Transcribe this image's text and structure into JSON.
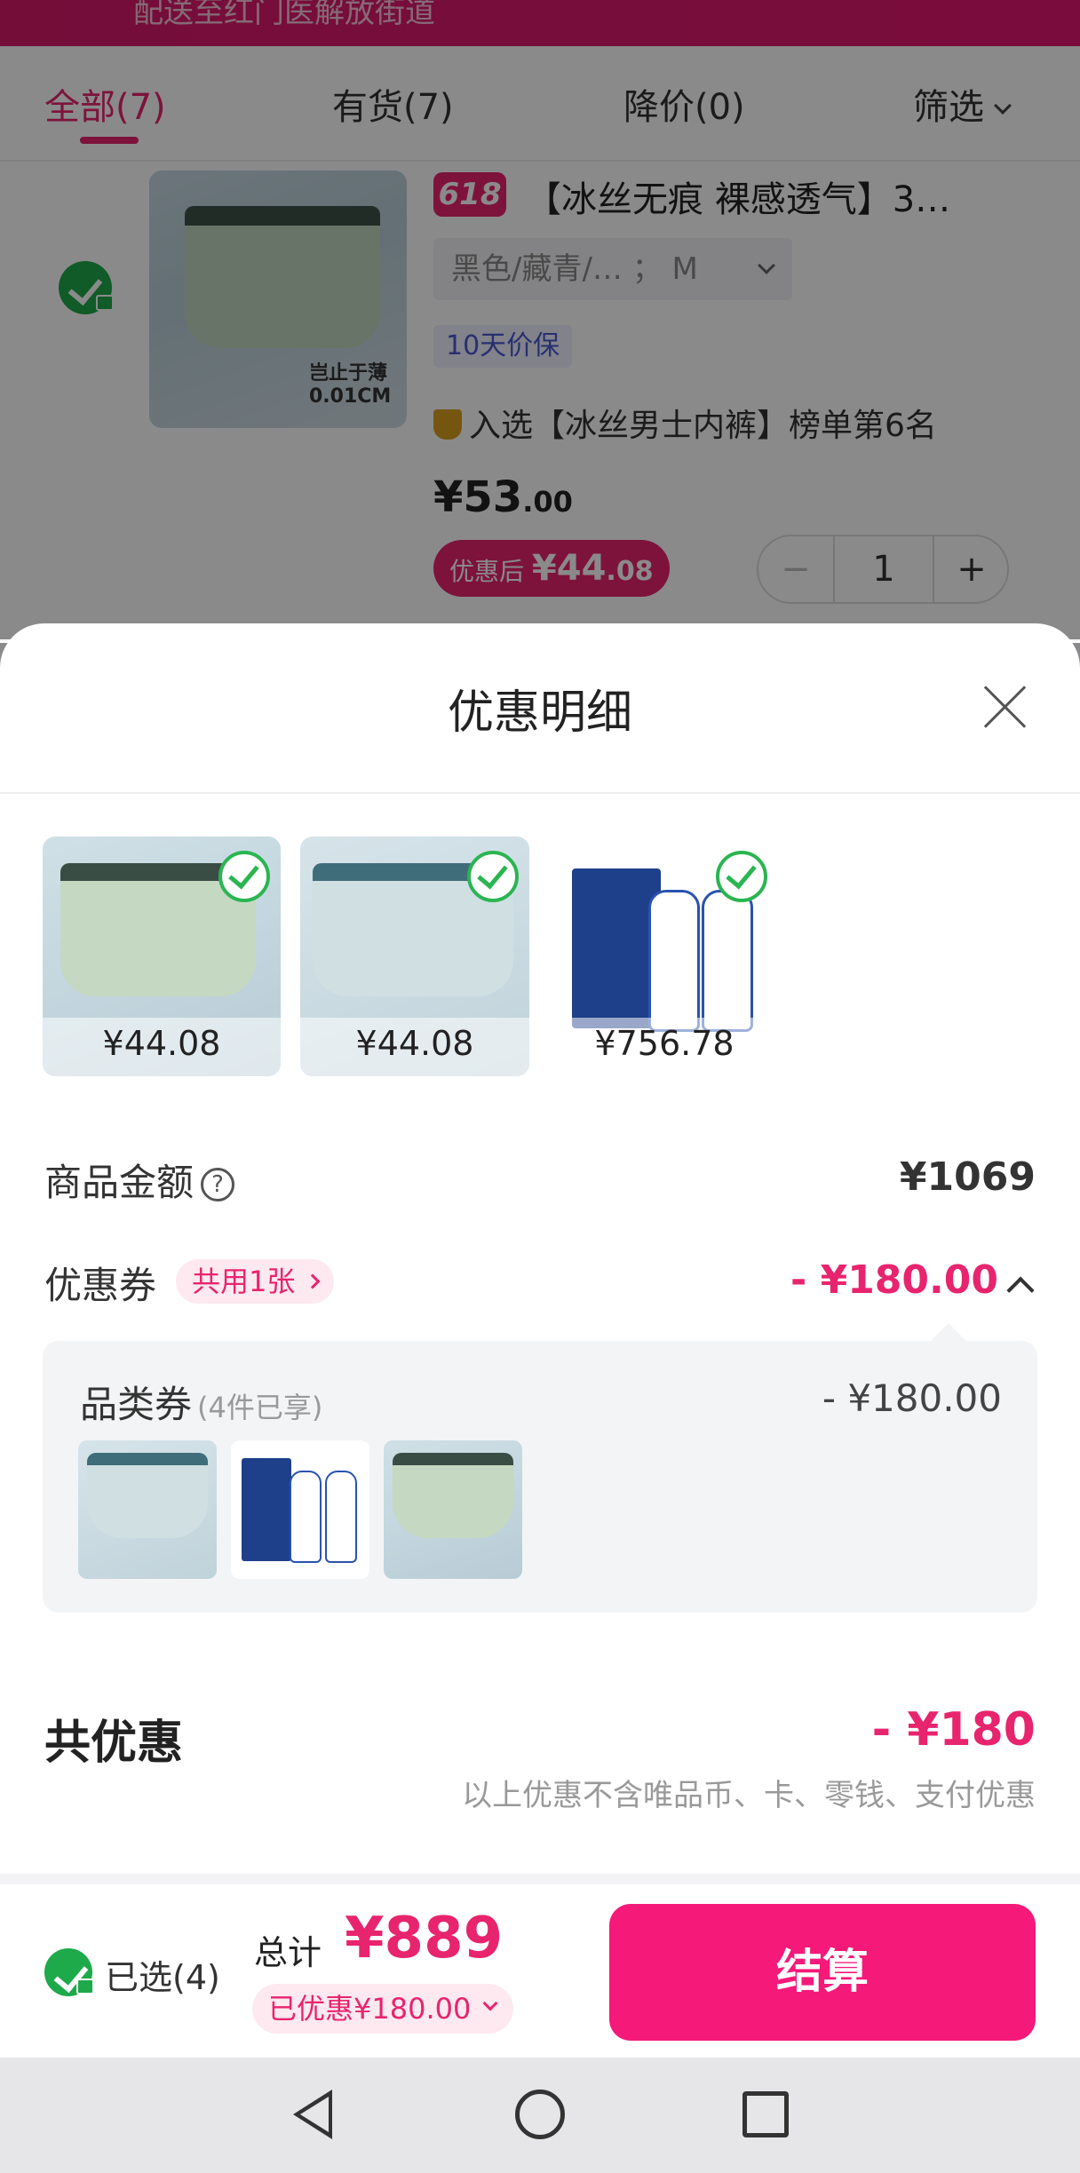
{
  "background": {
    "banner_text": "配送至红门医解放街道",
    "tabs": [
      {
        "label": "全部(7)",
        "active": true
      },
      {
        "label": "有货(7)",
        "active": false
      },
      {
        "label": "降价(0)",
        "active": false
      },
      {
        "label": "筛选",
        "active": false
      }
    ],
    "product": {
      "badge": "618",
      "title": "【冰丝无痕 裸感透气】3…",
      "sku": "黑色/藏青/…   ；  M",
      "price_protect": "10天价保",
      "rank": "入选【冰丝男士内裤】榜单第6名",
      "price_main": "¥53",
      "price_decimal": ".00",
      "after_discount_label": "优惠后",
      "after_discount_main": "¥44",
      "after_discount_decimal": ".08",
      "quantity": "1",
      "minus": "−",
      "plus": "+"
    }
  },
  "sheet": {
    "title": "优惠明细",
    "items": [
      {
        "price": "¥44.08",
        "checked": true
      },
      {
        "price": "¥44.08",
        "checked": true
      },
      {
        "price": "¥756.78",
        "checked": true
      }
    ],
    "product_amount": {
      "label": "商品金额",
      "help": "?",
      "value": "¥1069"
    },
    "coupon": {
      "label": "优惠券",
      "chip": "共用1张",
      "value": "- ¥180.00"
    },
    "detail": {
      "label": "品类券",
      "sub": "(4件已享)",
      "amount": "- ¥180.00"
    },
    "total_discount": {
      "label": "共优惠",
      "value": "- ¥180",
      "note": "以上优惠不含唯品币、卡、零钱、支付优惠"
    }
  },
  "checkout": {
    "selected": "已选(4)",
    "total_prefix": "总计",
    "total_price": "¥889",
    "saved": "已优惠¥180.00",
    "button": "结算"
  },
  "colors": {
    "accent": "#e8246e",
    "checkout_button": "#f5197a",
    "check_green": "#1ea94a"
  }
}
